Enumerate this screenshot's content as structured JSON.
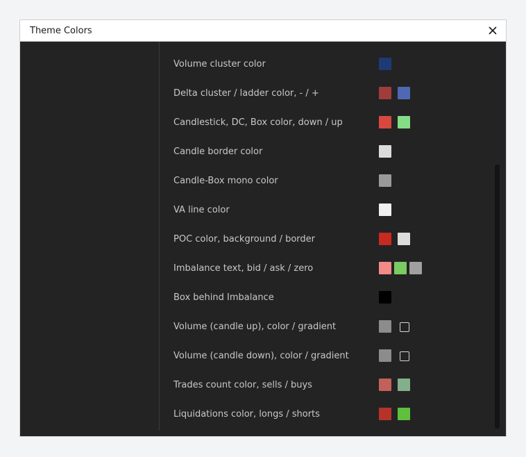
{
  "window": {
    "title": "Theme Colors"
  },
  "rows": [
    {
      "label": "Volume cluster color",
      "swatches": [
        "#1e3a74"
      ],
      "checkbox": false
    },
    {
      "label": "Delta cluster / ladder color, - / +",
      "swatches": [
        "#a13c3c",
        "#4f68b3"
      ],
      "checkbox": false
    },
    {
      "label": "Candlestick, DC, Box color, down / up",
      "swatches": [
        "#d9483f",
        "#85dc85"
      ],
      "checkbox": false
    },
    {
      "label": "Candle border color",
      "swatches": [
        "#dcdcdc"
      ],
      "checkbox": false
    },
    {
      "label": "Candle-Box mono color",
      "swatches": [
        "#9a9a9a"
      ],
      "checkbox": false
    },
    {
      "label": "VA line color",
      "swatches": [
        "#f0f0f0"
      ],
      "checkbox": false
    },
    {
      "label": "POC color, background / border",
      "swatches": [
        "#c82a1f",
        "#dcdcdc"
      ],
      "checkbox": false
    },
    {
      "label": "Imbalance text, bid / ask / zero",
      "swatches": [
        "#f08b87",
        "#7acb62",
        "#a0a0a0"
      ],
      "checkbox": false
    },
    {
      "label": "Box behind Imbalance",
      "swatches": [
        "#000000"
      ],
      "checkbox": false
    },
    {
      "label": "Volume (candle up), color / gradient",
      "swatches": [
        "#8c8c8c"
      ],
      "checkbox": true
    },
    {
      "label": "Volume (candle down), color / gradient",
      "swatches": [
        "#8c8c8c"
      ],
      "checkbox": true
    },
    {
      "label": "Trades count color, sells / buys",
      "swatches": [
        "#c4605c",
        "#82b08c"
      ],
      "checkbox": false
    },
    {
      "label": "Liquidations color, longs / shorts",
      "swatches": [
        "#b7332a",
        "#5fc03e"
      ],
      "checkbox": false
    }
  ],
  "icons": {
    "close": "close-icon"
  }
}
